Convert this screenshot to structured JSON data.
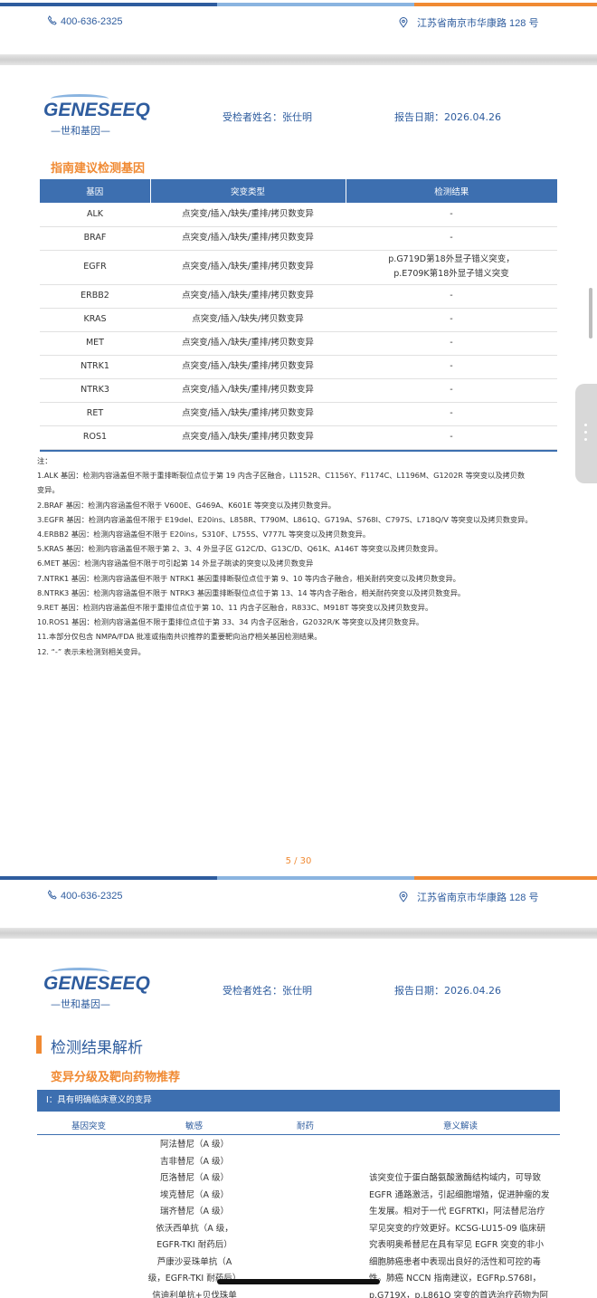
{
  "page1": {
    "phone": "400-636-2325",
    "address": "江苏省南京市华康路 128 号",
    "logo_text": "GENESEEQ",
    "logo_sub": "—世和基因—",
    "patient": "受检者姓名：张仕明",
    "report_date": "报告日期：2026.04.26",
    "section_title": "指南建议检测基因",
    "table": {
      "headers": [
        "基因",
        "突变类型",
        "检测结果"
      ],
      "rows": [
        {
          "gene": "ALK",
          "type": "点突变/插入/缺失/重排/拷贝数变异",
          "result": "-"
        },
        {
          "gene": "BRAF",
          "type": "点突变/插入/缺失/重排/拷贝数变异",
          "result": "-"
        },
        {
          "gene": "EGFR",
          "type": "点突变/插入/缺失/重排/拷贝数变异",
          "result": "p.G719D第18外显子错义突变，",
          "result2": "p.E709K第18外显子错义突变"
        },
        {
          "gene": "ERBB2",
          "type": "点突变/插入/缺失/重排/拷贝数变异",
          "result": "-"
        },
        {
          "gene": "KRAS",
          "type": "点突变/插入/缺失/拷贝数变异",
          "result": "-"
        },
        {
          "gene": "MET",
          "type": "点突变/插入/缺失/重排/拷贝数变异",
          "result": "-"
        },
        {
          "gene": "NTRK1",
          "type": "点突变/插入/缺失/重排/拷贝数变异",
          "result": "-"
        },
        {
          "gene": "NTRK3",
          "type": "点突变/插入/缺失/重排/拷贝数变异",
          "result": "-"
        },
        {
          "gene": "RET",
          "type": "点突变/插入/缺失/重排/拷贝数变异",
          "result": "-"
        },
        {
          "gene": "ROS1",
          "type": "点突变/插入/缺失/重排/拷贝数变异",
          "result": "-"
        }
      ]
    },
    "notes": [
      "注：",
      "1.ALK 基因：检测内容涵盖但不限于重排断裂位点位于第 19 内含子区融合，L1152R、C1156Y、F1174C、L1196M、G1202R 等突变以及拷贝数",
      "变异。",
      "2.BRAF 基因：检测内容涵盖但不限于 V600E、G469A、K601E 等突变以及拷贝数变异。",
      "3.EGFR 基因：检测内容涵盖但不限于 E19del、E20ins、L858R、T790M、L861Q、G719A、S768I、C797S、L718Q/V 等突变以及拷贝数变异。",
      "4.ERBB2 基因：检测内容涵盖但不限于 E20ins，S310F、L755S、V777L 等突变以及拷贝数变异。",
      "5.KRAS 基因：检测内容涵盖但不限于第 2、3、4 外显子区 G12C/D、G13C/D、Q61K、A146T 等突变以及拷贝数变异。",
      "6.MET 基因：检测内容涵盖但不限于可引起第 14 外显子跳读的突变以及拷贝数变异",
      "7.NTRK1 基因：检测内容涵盖但不限于 NTRK1 基因重排断裂位点位于第 9、10 等内含子融合，相关耐药突变以及拷贝数变异。",
      "8.NTRK3 基因：检测内容涵盖但不限于 NTRK3 基因重排断裂位点位于第 13、14 等内含子融合，相关耐药突变以及拷贝数变异。",
      "9.RET 基因：检测内容涵盖但不限于重排位点位于第 10、11 内含子区融合，R833C、M918T 等突变以及拷贝数变异。",
      "10.ROS1 基因：检测内容涵盖但不限于重排位点位于第 33、34 内含子区融合，G2032R/K 等突变以及拷贝数变异。",
      "11.本部分仅包含 NMPA/FDA 批准或指南共识推荐的重要靶向治疗相关基因检测结果。",
      "12. “-” 表示未检测到相关变异。"
    ],
    "page_number": "5 / 30"
  },
  "page2": {
    "phone": "400-636-2325",
    "address": "江苏省南京市华康路 128 号",
    "logo_text": "GENESEEQ",
    "logo_sub": "—世和基因—",
    "patient": "受检者姓名：张仕明",
    "report_date": "报告日期：2026.04.26",
    "big_title": "检测结果解析",
    "section_title": "变异分级及靶向药物推荐",
    "level_bar": "I：具有明确临床意义的变异",
    "columns": [
      "基因突变",
      "敏感",
      "耐药",
      "意义解读"
    ],
    "drugs": [
      "阿法替尼（A 级）",
      "吉非替尼（A 级）",
      "厄洛替尼（A 级）",
      "埃克替尼（A 级）",
      "瑞齐替尼（A 级）",
      "依沃西单抗（A 级，",
      "EGFR-TKI 耐药后）",
      "芦康沙妥珠单抗（A",
      "级，EGFR-TKI 耐药后）",
      "信迪利单抗+贝伐珠单"
    ],
    "interpretation": [
      "该突变位于蛋白酪氨酸激酶结构域内，可导致",
      "EGFR 通路激活，引起细胞增殖，促进肿瘤的发",
      "生发展。相对于一代 EGFRTKI，阿法替尼治疗",
      "罕见突变的疗效更好。KCSG-LU15-09 临床研",
      "究表明奥希替尼在具有罕见 EGFR 突变的非小",
      "细胞肺癌患者中表现出良好的活性和可控的毒",
      "性。肺癌 NCCN 指南建议，EGFRp.S768I，",
      "p.G719X，p.L861Q 突变的首选治疗药物为阿"
    ]
  }
}
